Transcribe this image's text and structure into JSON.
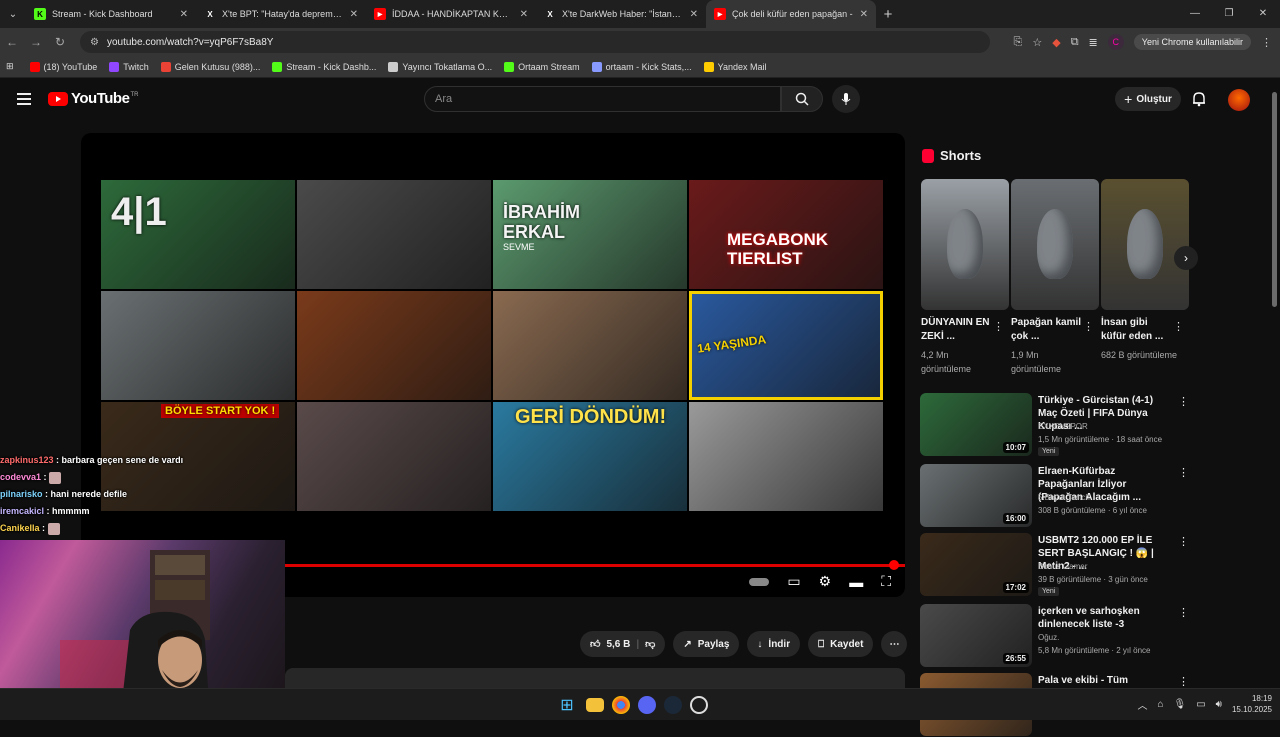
{
  "browser": {
    "tabs": [
      {
        "label": "Stream - Kick Dashboard",
        "icon": "kick-icon",
        "color": "#53fc18"
      },
      {
        "label": "X'te BPT: \"Hatay'da depremin a...",
        "icon": "x-icon",
        "color": "#ffffff"
      },
      {
        "label": "İDDAA - HANDİKAPTAN KAZAN",
        "icon": "youtube-icon",
        "color": "#ff0000"
      },
      {
        "label": "X'te DarkWeb Haber: \"İstanbul'...",
        "icon": "x-icon",
        "color": "#ffffff"
      },
      {
        "label": "Çok deli küfür eden papağan -",
        "icon": "youtube-icon",
        "color": "#ff0000"
      }
    ],
    "url": "youtube.com/watch?v=yqP6F7sBa8Y",
    "profile_letter": "C",
    "update_pill": "Yeni Chrome kullanılabilir",
    "bookmarks": [
      {
        "label": "(18) YouTube",
        "color": "#ff0000"
      },
      {
        "label": "Twitch",
        "color": "#9146ff"
      },
      {
        "label": "Gelen Kutusu (988)...",
        "color": "#ea4335"
      },
      {
        "label": "Stream - Kick Dashb...",
        "color": "#53fc18"
      },
      {
        "label": "Yayıncı Tokatlama O...",
        "color": "#cccccc"
      },
      {
        "label": "Ortaam Stream",
        "color": "#53fc18"
      },
      {
        "label": "ortaam - Kick Stats,...",
        "color": "#8899ff"
      },
      {
        "label": "Yandex Mail",
        "color": "#ffcc00"
      }
    ]
  },
  "youtube": {
    "logo_text": "YouTube",
    "country": "TR",
    "search_placeholder": "Ara",
    "create_label": "Oluştur"
  },
  "player": {
    "end_tiles": [
      {
        "caption": "4|1",
        "bg": "#2d6a3a"
      },
      {
        "caption": "",
        "bg": "#4a4a4a"
      },
      {
        "caption": "İBRAHİM ERKAL",
        "sub": "SEVME",
        "bg": "#5b9a6e"
      },
      {
        "caption": "MEGABONK TIERLIST",
        "bg": "#6a1a1a"
      },
      {
        "caption": "",
        "bg": "#6a7072"
      },
      {
        "caption": "",
        "bg": "#7a3a1a"
      },
      {
        "caption": "",
        "bg": "#8a6a50"
      },
      {
        "caption": "14 YAŞINDA",
        "bg": "#2a5aa0"
      },
      {
        "caption": "BÖYLE START YOK !",
        "bg": "#3a2a1a"
      },
      {
        "caption": "",
        "bg": "#5a4a4a"
      },
      {
        "caption": "GERİ DÖNDÜM!",
        "bg": "#2a7aa0"
      },
      {
        "caption": "",
        "bg": "#9a9a9a"
      }
    ],
    "progress_fraction": 0.99
  },
  "actions": {
    "like_count": "5,6 B",
    "share": "Paylaş",
    "download": "İndir",
    "save": "Kaydet"
  },
  "shorts": {
    "heading": "Shorts",
    "items": [
      {
        "title": "DÜNYANIN EN ZEKİ ...",
        "views": "4,2 Mn görüntüleme",
        "bg": "#9aa0a6"
      },
      {
        "title": "Papağan kamil çok ...",
        "views": "1,9 Mn görüntüleme",
        "bg": "#6a6e72"
      },
      {
        "title": "İnsan gibi küfür eden ...",
        "views": "682 B görüntüleme",
        "bg": "#5a5030"
      }
    ]
  },
  "related": [
    {
      "title": "Türkiye - Gürcistan (4-1) Maç Özeti | FIFA Dünya Kupası ...",
      "channel": "EXXENSPOR",
      "meta": "1,5 Mn görüntüleme · 18 saat önce",
      "badge": "Yeni",
      "duration": "10:07",
      "bg": "#2d6a3a"
    },
    {
      "title": "Elraen-Küfürbaz Papağanları İzliyor (Papağan Alacağım ...",
      "channel": "5.Boyut Twitch",
      "meta": "308 B görüntüleme · 6 yıl önce",
      "badge": "",
      "duration": "16:00",
      "bg": "#6a7072"
    },
    {
      "title": "USBMT2 120.000 EP İLE SERT BAŞLANGIÇ ! 😱 | Metin2 - ...",
      "channel": "Bonus Gamer",
      "meta": "39 B görüntüleme · 3 gün önce",
      "badge": "Yeni",
      "duration": "17:02",
      "bg": "#3a2a1a"
    },
    {
      "title": "içerken ve sarhoşken dinlenecek liste -3",
      "channel": "Oğuz.",
      "meta": "5,8 Mn görüntüleme · 2 yıl önce",
      "badge": "",
      "duration": "26:55",
      "bg": "#4a4a4a"
    },
    {
      "title": "Pala ve ekibi - Tüm sahneler",
      "channel": "",
      "meta": "",
      "badge": "",
      "duration": "",
      "bg": "#8a5a30"
    }
  ],
  "chat": [
    {
      "user": "zapkinus123",
      "msg": "barbara geçen sene de vardı",
      "color": "#ff6b6b"
    },
    {
      "user": "codevva1",
      "msg": "",
      "color": "#ff8ad8"
    },
    {
      "user": "pilnarisko",
      "msg": "hani nerede defile",
      "color": "#7dd3fc"
    },
    {
      "user": "iremcakicl",
      "msg": "hmmmm",
      "color": "#c4b5fd"
    },
    {
      "user": "Canikella",
      "msg": "",
      "color": "#fcd34d"
    }
  ],
  "taskbar": {
    "time": "18:19",
    "date": "15.10.2025"
  }
}
